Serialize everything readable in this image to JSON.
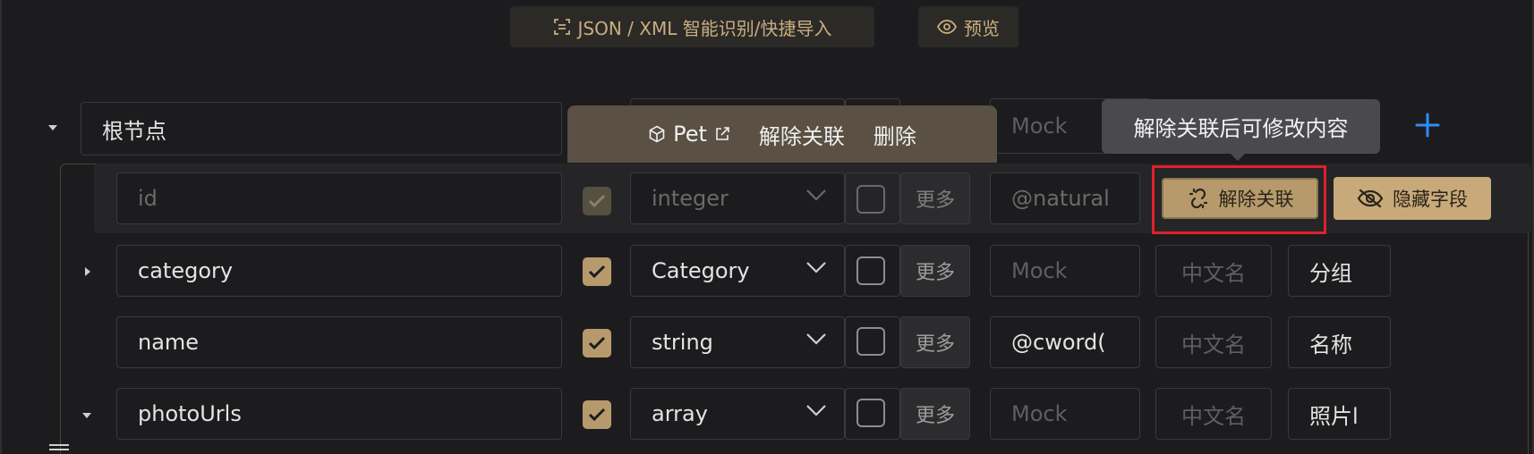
{
  "toolbar": {
    "import_label": "JSON / XML 智能识别/快捷导入",
    "preview_label": "预览"
  },
  "root": {
    "name_value": "根节点",
    "mock_placeholder": "Mock"
  },
  "ref_popover": {
    "model_name": "Pet",
    "unlink_label": "解除关联",
    "delete_label": "删除"
  },
  "tooltip": {
    "text": "解除关联后可修改内容"
  },
  "highlighted_row": {
    "unlink_button": "解除关联",
    "hide_field_button": "隐藏字段"
  },
  "rows": [
    {
      "name": "id",
      "required": true,
      "type": "integer",
      "more": "更多",
      "mock": "@natural",
      "cn_name": "",
      "desc": ""
    },
    {
      "name": "category",
      "required": true,
      "type": "Category",
      "more": "更多",
      "mock": "Mock",
      "cn_name": "中文名",
      "desc": "分组"
    },
    {
      "name": "name",
      "required": true,
      "type": "string",
      "more": "更多",
      "mock": "@cword(",
      "cn_name": "中文名",
      "desc": "名称"
    },
    {
      "name": "photoUrls",
      "required": true,
      "type": "array",
      "more": "更多",
      "mock": "Mock",
      "cn_name": "中文名",
      "desc": "照片l"
    }
  ],
  "colors": {
    "accent_gold": "#b79a6c",
    "highlight_red": "#e0202a",
    "plus_blue": "#2f8cff"
  }
}
